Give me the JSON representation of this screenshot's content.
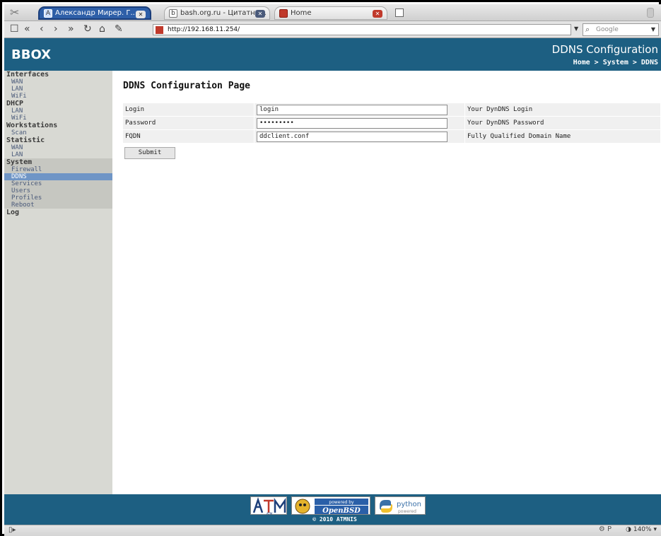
{
  "browser": {
    "tabs": [
      {
        "label": "Александр Мирер. Г..."
      },
      {
        "label": "bash.org.ru - Цитатни..."
      },
      {
        "label": "Home"
      }
    ],
    "url": "http://192.168.11.254/",
    "search_placeholder": "Google",
    "zoom": "140%",
    "status_icons": "P"
  },
  "header": {
    "brand": "BBOX",
    "title": "DDNS Configuration",
    "breadcrumb": "Home > System > DDNS"
  },
  "sidebar": {
    "interfaces": {
      "label": "Interfaces",
      "items": [
        "WAN",
        "LAN",
        "WiFi"
      ]
    },
    "dhcp": {
      "label": "DHCP",
      "items": [
        "LAN",
        "WiFi"
      ]
    },
    "workstations": {
      "label": "Workstations",
      "items": [
        "Scan"
      ]
    },
    "statistic": {
      "label": "Statistic",
      "items": [
        "WAN",
        "LAN"
      ]
    },
    "system": {
      "label": "System",
      "items": [
        "Firewall",
        "DDNS",
        "Services",
        "Users",
        "Profiles",
        "Reboot"
      ]
    },
    "log": {
      "label": "Log"
    }
  },
  "main": {
    "page_title": "DDNS Configuration Page",
    "fields": [
      {
        "label": "Login",
        "value": "login",
        "help": "Your DynDNS Login"
      },
      {
        "label": "Password",
        "value": "•••••••••",
        "help": "Your DynDNS Password"
      },
      {
        "label": "FQDN",
        "value": "ddclient.conf",
        "help": "Fully Qualified Domain Name"
      }
    ],
    "submit_label": "Submit"
  },
  "footer": {
    "logos": {
      "atm": "ATM",
      "openbsd_top": "powered by",
      "openbsd": "OpenBSD",
      "python": "python",
      "python_sub": "powered"
    },
    "copyright": "© 2010 ATMNIS"
  },
  "colors": {
    "header": "#1d5f82",
    "sidebar": "#d8d9d3",
    "active": "#6f95c6"
  }
}
